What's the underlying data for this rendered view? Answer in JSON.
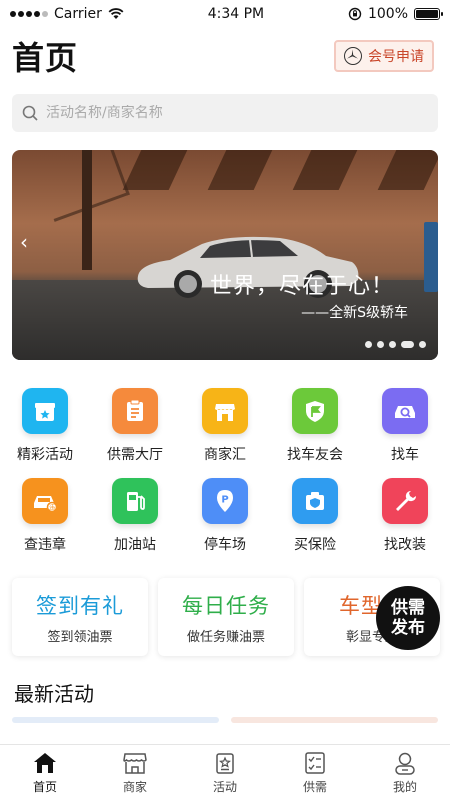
{
  "status_bar": {
    "carrier": "Carrier",
    "time": "4:34 PM",
    "battery": "100%"
  },
  "header": {
    "title": "首页",
    "member_button": "会号申请"
  },
  "search": {
    "placeholder": "活动名称/商家名称"
  },
  "banner": {
    "slogan": "世界，尽在于心！",
    "subtitle": "——全新S级轿车",
    "slide_count": 5,
    "active_slide": 4
  },
  "grid": [
    {
      "label": "精彩活动",
      "icon": "gift-box-icon",
      "color": "#1fb5f0"
    },
    {
      "label": "供需大厅",
      "icon": "clipboard-icon",
      "color": "#f58a3c"
    },
    {
      "label": "商家汇",
      "icon": "storefront-icon",
      "color": "#f7b417"
    },
    {
      "label": "找车友会",
      "icon": "flag-shield-icon",
      "color": "#6cc93a"
    },
    {
      "label": "找车",
      "icon": "car-search-icon",
      "color": "#7b6cf2"
    },
    {
      "label": "查违章",
      "icon": "car-violation-icon",
      "color": "#f6921e"
    },
    {
      "label": "加油站",
      "icon": "fuel-pump-icon",
      "color": "#2fc25b"
    },
    {
      "label": "停车场",
      "icon": "parking-icon",
      "color": "#4e8ef7"
    },
    {
      "label": "买保险",
      "icon": "insurance-icon",
      "color": "#2f9cf0"
    },
    {
      "label": "找改装",
      "icon": "wrench-icon",
      "color": "#f0445a"
    }
  ],
  "promos": [
    {
      "title": "签到有礼",
      "sub": "签到领油票",
      "color": "#1b9bd8"
    },
    {
      "title": "每日任务",
      "sub": "做任务赚油票",
      "color": "#2fae4a"
    },
    {
      "title": "车型认",
      "sub": "彰显专属",
      "color": "#e0662c"
    }
  ],
  "fab": {
    "line1": "供需",
    "line2": "发布"
  },
  "section": {
    "title": "最新活动"
  },
  "tabs": [
    {
      "label": "首页",
      "icon": "home-icon",
      "active": true
    },
    {
      "label": "商家",
      "icon": "shop-icon",
      "active": false
    },
    {
      "label": "活动",
      "icon": "activity-icon",
      "active": false
    },
    {
      "label": "供需",
      "icon": "checklist-icon",
      "active": false
    },
    {
      "label": "我的",
      "icon": "profile-icon",
      "active": false
    }
  ]
}
